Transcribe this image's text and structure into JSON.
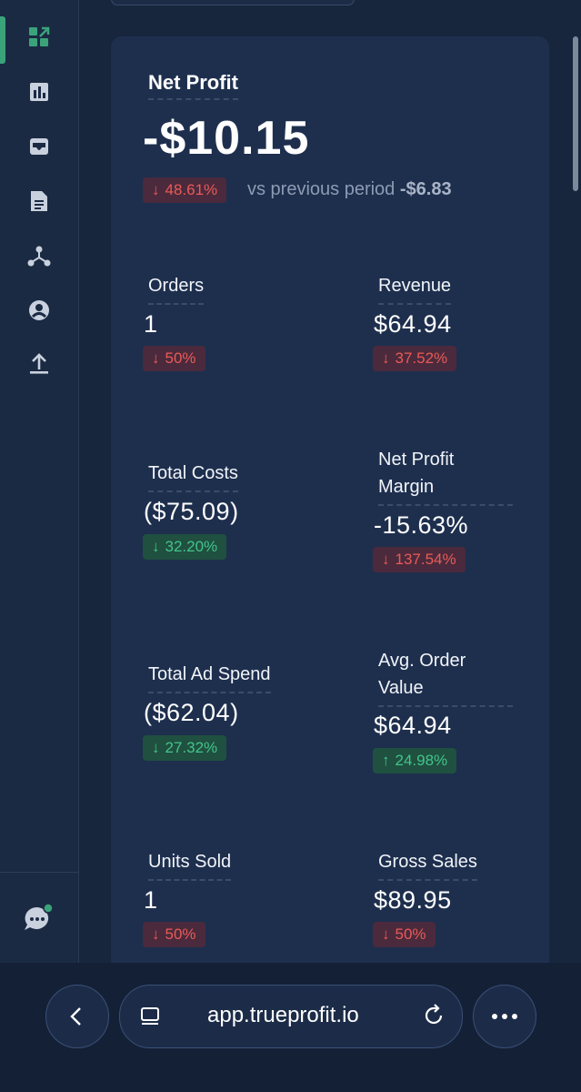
{
  "sidebar": {
    "icons": [
      "dashboard-icon",
      "bar-chart-icon",
      "inbox-icon",
      "document-icon",
      "network-icon",
      "user-circle-icon",
      "upload-icon"
    ],
    "chat_icon": "chat-icon",
    "accent": "#3aa37a"
  },
  "net_profit": {
    "title": "Net Profit",
    "value": "-$10.15",
    "change": "48.61%",
    "compare_label": "vs previous period",
    "previous_value": "-$6.83"
  },
  "metrics": [
    {
      "label": "Orders",
      "value": "1",
      "change": "50%",
      "direction": "down",
      "tone": "red"
    },
    {
      "label": "Revenue",
      "value": "$64.94",
      "change": "37.52%",
      "direction": "down",
      "tone": "red"
    },
    {
      "label": "Total Costs",
      "value": "($75.09)",
      "change": "32.20%",
      "direction": "down",
      "tone": "green"
    },
    {
      "label_line1": "Net Profit",
      "label_line2": "Margin",
      "value": "-15.63%",
      "change": "137.54%",
      "direction": "down",
      "tone": "red"
    },
    {
      "label": "Total Ad Spend",
      "value": "($62.04)",
      "change": "27.32%",
      "direction": "down",
      "tone": "green"
    },
    {
      "label_line1": "Avg. Order",
      "label_line2": "Value",
      "value": "$64.94",
      "change": "24.98%",
      "direction": "up",
      "tone": "green"
    },
    {
      "label": "Units Sold",
      "value": "1",
      "change": "50%",
      "direction": "down",
      "tone": "red"
    },
    {
      "label": "Gross Sales",
      "value": "$89.95",
      "change": "50%",
      "direction": "down",
      "tone": "red"
    }
  ],
  "browser": {
    "url": "app.trueprofit.io",
    "arrow_down": "↓",
    "arrow_up": "↑"
  }
}
